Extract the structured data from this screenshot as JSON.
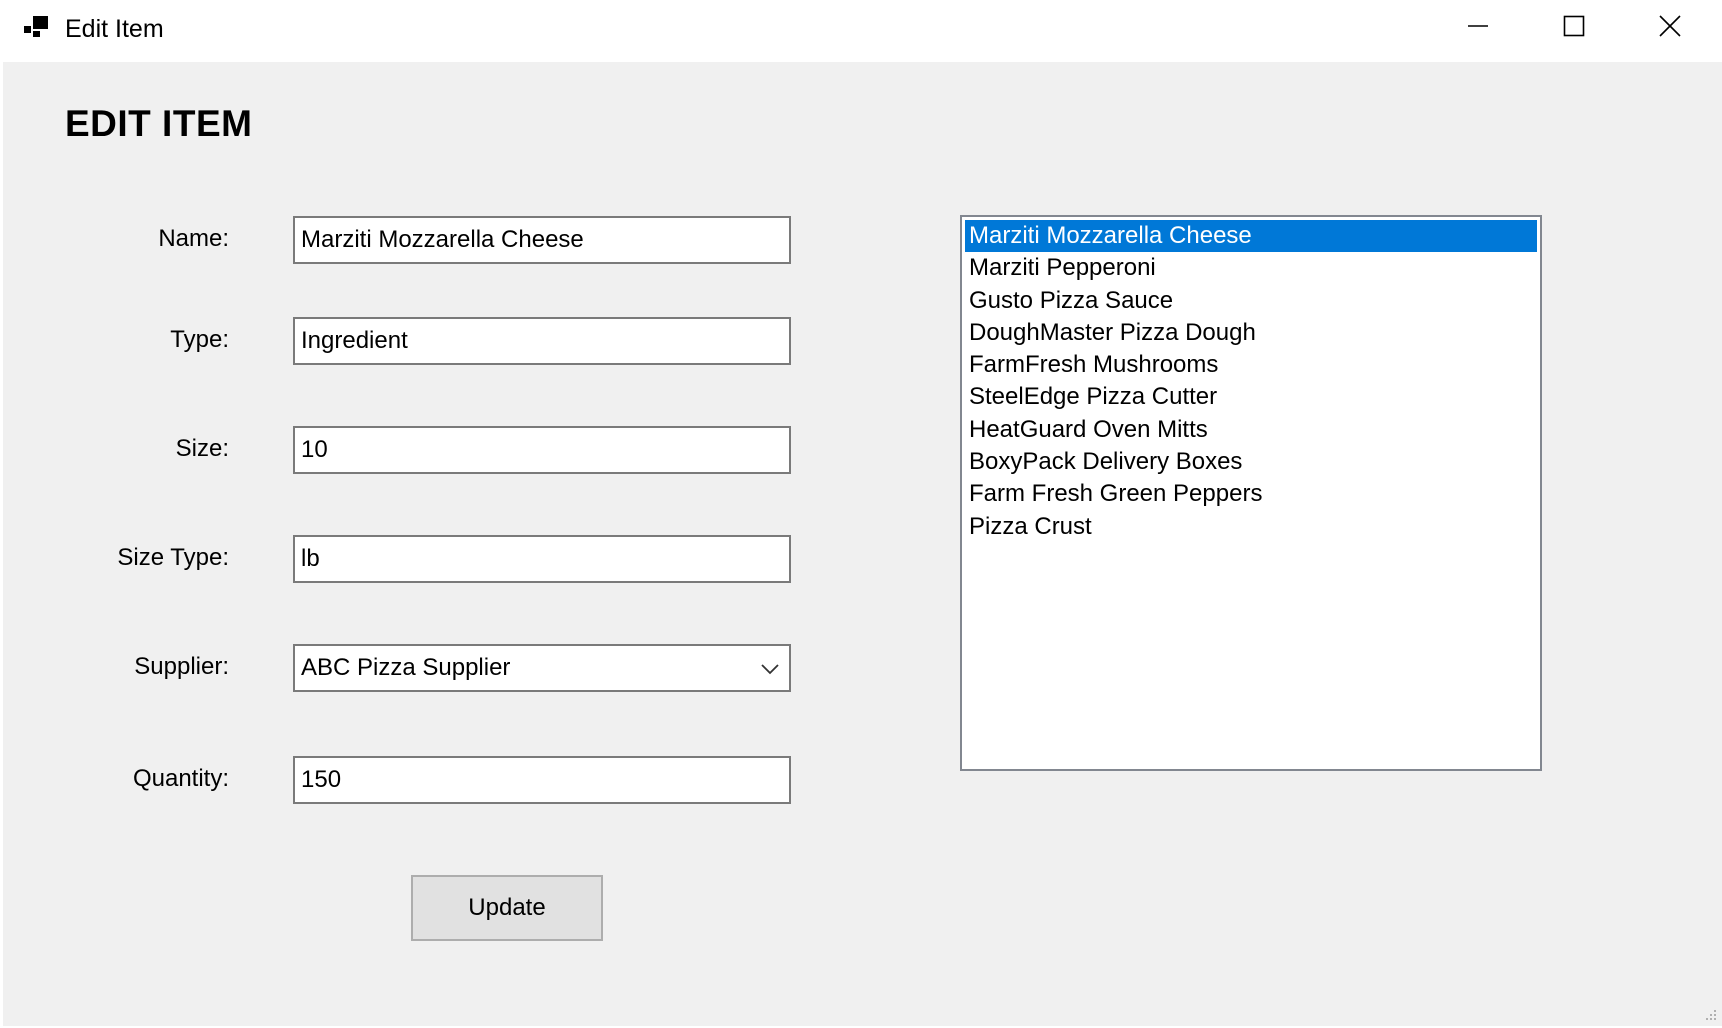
{
  "window": {
    "title": "Edit Item",
    "icon": "app-window-icon",
    "controls": [
      "minimize-icon",
      "maximize-icon",
      "close-icon"
    ]
  },
  "form": {
    "heading": "EDIT ITEM",
    "fields": {
      "name": {
        "label": "Name:",
        "value": "Marziti Mozzarella Cheese"
      },
      "type": {
        "label": "Type:",
        "value": "Ingredient"
      },
      "size": {
        "label": "Size:",
        "value": "10"
      },
      "size_type": {
        "label": "Size Type:",
        "value": "lb"
      },
      "supplier": {
        "label": "Supplier:",
        "selected": "ABC Pizza Supplier"
      },
      "quantity": {
        "label": "Quantity:",
        "value": "150"
      }
    },
    "update_label": "Update"
  },
  "item_list": {
    "selected_index": 0,
    "items": [
      "Marziti Mozzarella Cheese",
      "Marziti Pepperoni",
      "Gusto Pizza Sauce",
      "DoughMaster Pizza Dough",
      "FarmFresh Mushrooms",
      "SteelEdge Pizza Cutter",
      "HeatGuard Oven Mitts",
      "BoxyPack Delivery Boxes",
      "Farm Fresh Green Peppers",
      "Pizza Crust"
    ]
  },
  "colors": {
    "selection": "#0078d7",
    "client_background": "#f0f0f0",
    "button_background": "#e1e1e1"
  }
}
